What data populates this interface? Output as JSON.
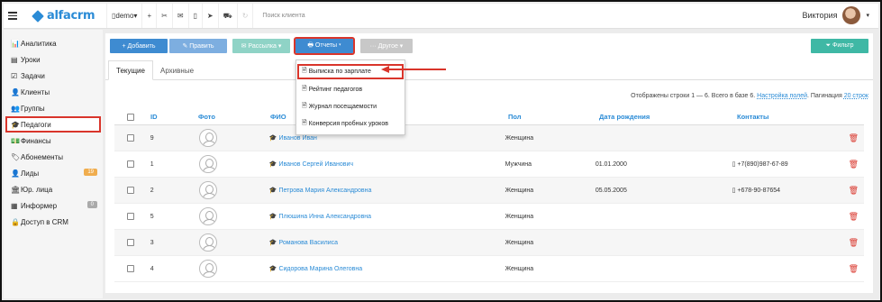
{
  "app": {
    "logo_text": "alfacrm",
    "brand_color": "#2a8bd6",
    "highlight_color": "#d9352b"
  },
  "topbar": {
    "branch": "demo",
    "branch_caret": "▾",
    "icons": [
      "plus-icon",
      "wrench-icon",
      "mail-icon",
      "phone-icon",
      "telegram-icon",
      "cart-icon",
      "refresh-icon"
    ],
    "search_placeholder": "Поиск клиента",
    "user_name": "Виктория",
    "user_caret": "▾"
  },
  "sidebar": {
    "items": [
      {
        "label": "Аналитика",
        "icon": "📊"
      },
      {
        "label": "Уроки",
        "icon": "▤"
      },
      {
        "label": "Задачи",
        "icon": "☑"
      },
      {
        "label": "Клиенты",
        "icon": "👤"
      },
      {
        "label": "Группы",
        "icon": "👥"
      },
      {
        "label": "Педагоги",
        "icon": "🎓",
        "active": true
      },
      {
        "label": "Финансы",
        "icon": "💵"
      },
      {
        "label": "Абонементы",
        "icon": "🏷"
      },
      {
        "label": "Лиды",
        "icon": "👤",
        "badge": "19"
      },
      {
        "label": "Юр. лица",
        "icon": "🏛"
      },
      {
        "label": "Информер",
        "icon": "▦",
        "badge": "0"
      },
      {
        "label": "Доступ в CRM",
        "icon": "🔒"
      }
    ]
  },
  "toolbar": {
    "add": "+ Добавить",
    "edit": "✎ Править",
    "mail": "✉ Рассылка ▾",
    "reports": "🖶 Отчеты ▾",
    "other": "··· Другое ▾",
    "filter": "⏷ Фильтр"
  },
  "dropdown": {
    "items": [
      "Выписка по зарплате",
      "Рейтинг педагогов",
      "Журнал посещаемости",
      "Конверсия пробных уроков"
    ]
  },
  "tabs": [
    "Текущие",
    "Архивные"
  ],
  "info": {
    "shown": "Отображены строки 1 — 6. Всего в базе 6.",
    "settings": "Настройка полей",
    "pagination_label": "Пагинация",
    "pagination_value": "20 строк"
  },
  "table": {
    "headers": {
      "id": "ID",
      "photo": "Фото",
      "name": "ФИО",
      "gender": "Пол",
      "birthdate": "Дата рождения",
      "contacts": "Контакты"
    },
    "rows": [
      {
        "id": "9",
        "name": "Иванов Иван",
        "gender": "Женщина",
        "birthdate": "",
        "phone": ""
      },
      {
        "id": "1",
        "name": "Иванов Сергей Иванович",
        "gender": "Мужчина",
        "birthdate": "01.01.2000",
        "phone": "+7(890)987-67-89"
      },
      {
        "id": "2",
        "name": "Петрова Мария Александровна",
        "gender": "Женщина",
        "birthdate": "05.05.2005",
        "phone": "+678-90-87654"
      },
      {
        "id": "5",
        "name": "Плюшина Инна Александровна",
        "gender": "Женщина",
        "birthdate": "",
        "phone": ""
      },
      {
        "id": "3",
        "name": "Романова Василиса",
        "gender": "Женщина",
        "birthdate": "",
        "phone": ""
      },
      {
        "id": "4",
        "name": "Сидорова Марина Олеговна",
        "gender": "Женщина",
        "birthdate": "",
        "phone": ""
      }
    ]
  }
}
